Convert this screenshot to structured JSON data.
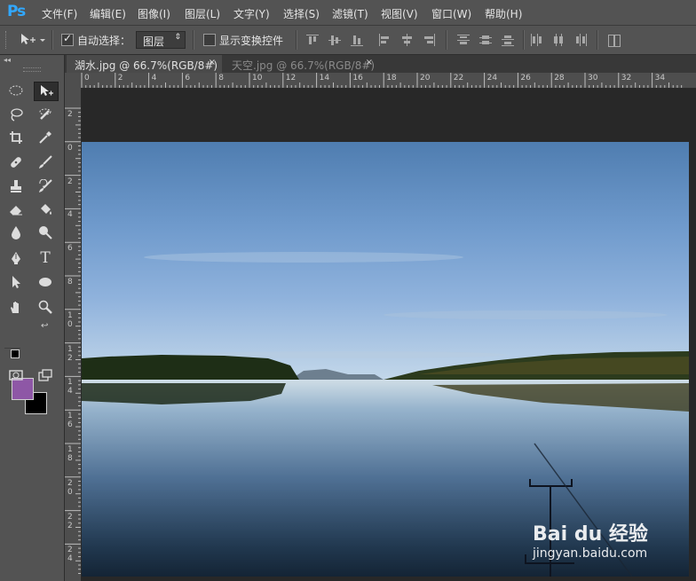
{
  "app": {
    "logo": "Ps",
    "accent_color": "#31a8ff"
  },
  "menu": [
    "文件(F)",
    "编辑(E)",
    "图像(I)",
    "图层(L)",
    "文字(Y)",
    "选择(S)",
    "滤镜(T)",
    "视图(V)",
    "窗口(W)",
    "帮助(H)"
  ],
  "options": {
    "auto_select_label": "自动选择：",
    "auto_select_checked": true,
    "auto_select_target": "图层",
    "show_transform_label": "显示变换控件",
    "show_transform_checked": false
  },
  "tabs": [
    {
      "label": "湖水.jpg @ 66.7%(RGB/8#)",
      "close": "×",
      "active": true
    },
    {
      "label": "天空.jpg @ 66.7%(RGB/8#)",
      "close": "×",
      "active": false
    }
  ],
  "ruler_top": [
    "0",
    "2",
    "4",
    "6",
    "8",
    "10",
    "12",
    "14",
    "16",
    "18",
    "20",
    "22",
    "24",
    "26",
    "28",
    "30",
    "32",
    "34"
  ],
  "ruler_left": [
    "2",
    "0",
    "2",
    "4",
    "6",
    "8",
    "1\n0",
    "1\n2",
    "1\n4",
    "1\n6",
    "1\n8",
    "2\n0",
    "2\n2",
    "2\n4"
  ],
  "colors": {
    "foreground": "#8e57a6",
    "background": "#000000"
  },
  "watermark": {
    "brand": "Bai du 经验",
    "url": "jingyan.baidu.com"
  },
  "tools": [
    "marquee-tool",
    "move-tool",
    "lasso-tool",
    "quick-selection-tool",
    "crop-tool",
    "eyedropper-tool",
    "healing-brush-tool",
    "brush-tool",
    "clone-stamp-tool",
    "history-brush-tool",
    "eraser-tool",
    "paint-bucket-tool",
    "blur-tool",
    "dodge-tool",
    "pen-tool",
    "type-tool",
    "path-selection-tool",
    "ellipse-tool",
    "hand-tool",
    "zoom-tool"
  ],
  "type_tool_glyph": "T"
}
